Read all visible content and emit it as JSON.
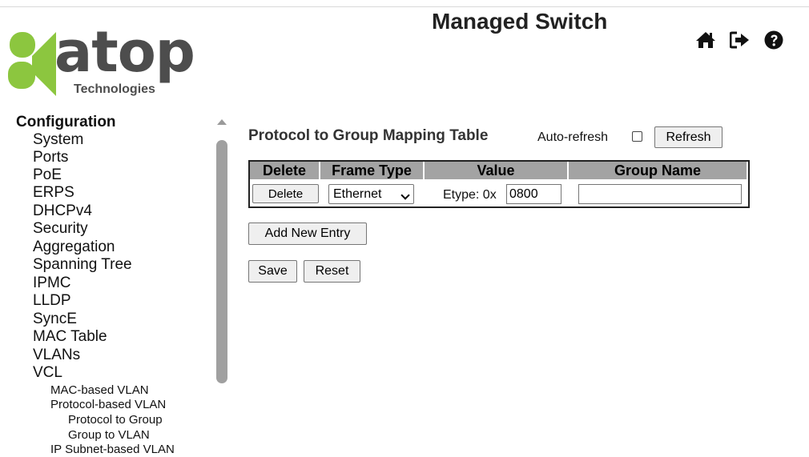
{
  "header": {
    "title": "Managed Switch",
    "icons": [
      "home-icon",
      "logout-icon",
      "help-icon"
    ]
  },
  "logo": {
    "text": "atop",
    "subtext": "Technologies",
    "colors": {
      "green": "#8cc63f",
      "gray": "#4d4d4d"
    }
  },
  "sidebar": {
    "heading": "Configuration",
    "items": [
      "System",
      "Ports",
      "PoE",
      "ERPS",
      "DHCPv4",
      "Security",
      "Aggregation",
      "Spanning Tree",
      "IPMC",
      "LLDP",
      "SyncE",
      "MAC Table",
      "VLANs",
      "VCL"
    ],
    "sub_items": [
      "MAC-based VLAN",
      "Protocol-based VLAN"
    ],
    "sub_sub_items": [
      "Protocol to Group",
      "Group to VLAN"
    ],
    "sub_items_after": [
      "IP Subnet-based VLAN"
    ]
  },
  "main": {
    "title": "Protocol to Group Mapping Table",
    "auto_refresh_label": "Auto-refresh",
    "auto_refresh_checked": false,
    "refresh_label": "Refresh",
    "table": {
      "headers": [
        "Delete",
        "Frame Type",
        "Value",
        "Group Name"
      ],
      "row": {
        "delete_label": "Delete",
        "frame_type": "Ethernet",
        "value_label": "Etype: 0x",
        "value": "0800",
        "group_name": ""
      }
    },
    "add_entry_label": "Add New Entry",
    "save_label": "Save",
    "reset_label": "Reset"
  },
  "colors": {
    "table_header": "#a3a3a3",
    "button_bg": "#efefef"
  }
}
